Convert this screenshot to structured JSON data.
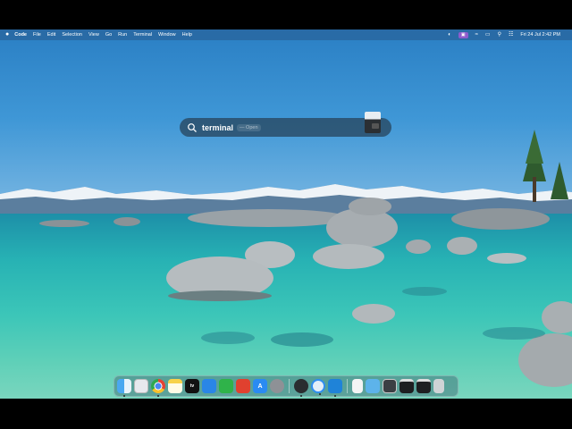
{
  "menubar": {
    "app_name": "Code",
    "items": [
      "File",
      "Edit",
      "Selection",
      "View",
      "Go",
      "Run",
      "Terminal",
      "Window",
      "Help"
    ],
    "datetime": "Fri 24 Jul  2:42 PM"
  },
  "spotlight": {
    "query": "terminal",
    "hint": "— Open"
  },
  "dock": {
    "apps": [
      "finder",
      "launchpad",
      "chrome",
      "notes",
      "apple-tv",
      "keynote",
      "numbers",
      "pdf-expert",
      "app-store",
      "system-settings",
      "activity-monitor",
      "quicktime",
      "vscode",
      "textedit",
      "downloads-folder",
      "screen-recording",
      "terminal",
      "terminal-2",
      "trash"
    ]
  }
}
